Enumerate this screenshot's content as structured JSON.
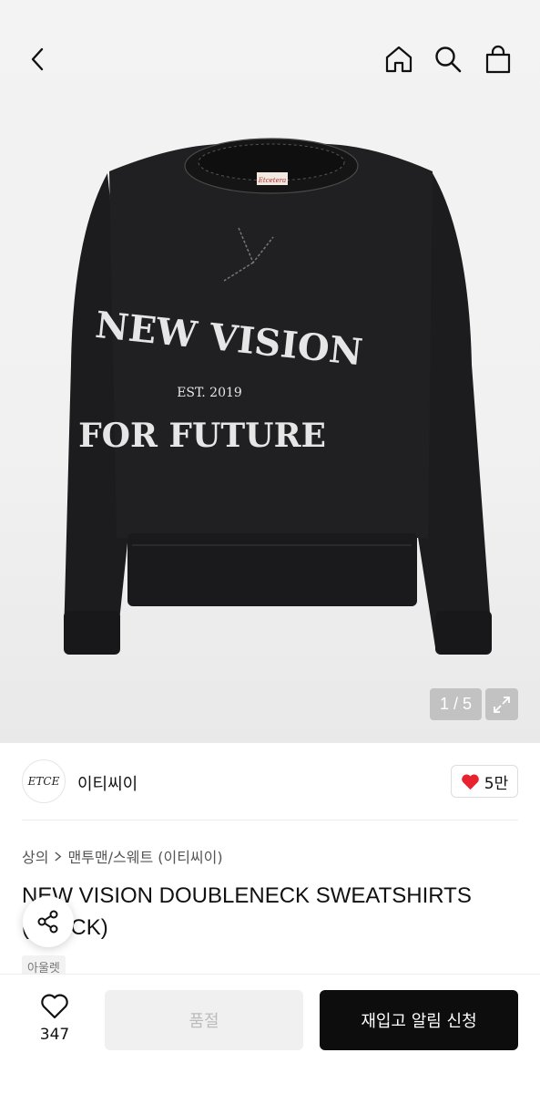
{
  "hero": {
    "counter": "1 / 5",
    "print_line1": "NEW VISION",
    "print_line2": "EST. 2019",
    "print_line3": "FOR FUTURE",
    "neck_label": "Etcetera"
  },
  "brand": {
    "logo_text": "ETCE",
    "name": "이티씨이",
    "like_count": "5만",
    "heart_color": "#e8222f"
  },
  "breadcrumb": {
    "level1": "상의",
    "separator": ">",
    "level2": "맨투맨/스웨트 (이티씨이)"
  },
  "product": {
    "title": "NEW VISION DOUBLENECK SWEATSHIRTS (BLACK)",
    "tag": "아울렛"
  },
  "bottom_bar": {
    "wish_count": "347",
    "soldout_label": "품절",
    "restock_label": "재입고 알림 신청"
  }
}
